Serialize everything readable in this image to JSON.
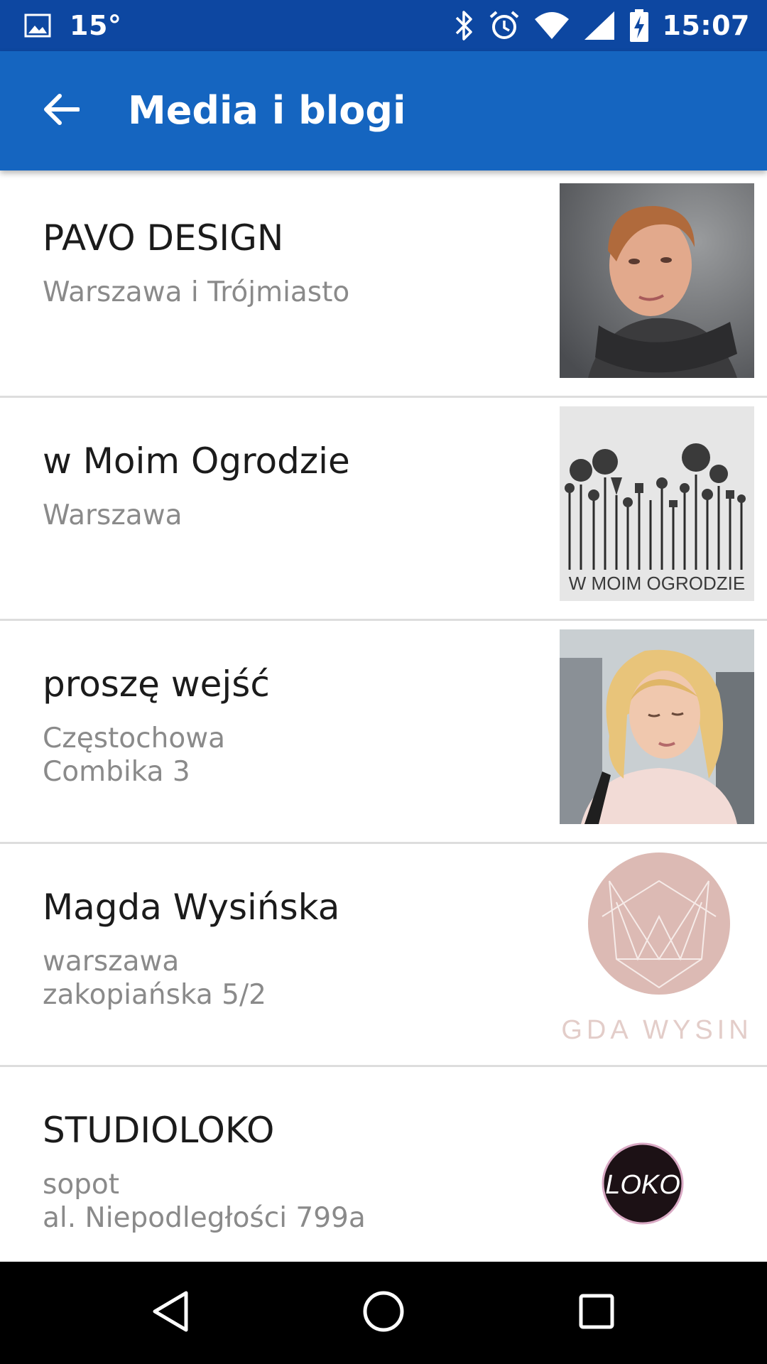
{
  "status_bar": {
    "temperature": "15°",
    "time": "15:07",
    "icons": [
      "image-icon",
      "bluetooth-icon",
      "alarm-icon",
      "wifi-icon",
      "signal-icon",
      "battery-charging-icon"
    ]
  },
  "app_bar": {
    "title": "Media i blogi",
    "back_icon": "arrow-back-icon",
    "color": "#1565c0",
    "status_color": "#0d47a1"
  },
  "items": [
    {
      "title": "PAVO DESIGN",
      "lines": [
        "Warszawa i Trójmiasto"
      ],
      "thumbnail": "portrait-photo"
    },
    {
      "title": "w Moim Ogrodzie",
      "lines": [
        "Warszawa"
      ],
      "thumbnail": "garden-tools-logo",
      "thumbnail_text": "W MOIM OGRODZIE"
    },
    {
      "title": "proszę wejść",
      "lines": [
        "Częstochowa",
        "Combika 3"
      ],
      "thumbnail": "portrait-photo"
    },
    {
      "title": "Magda Wysińska",
      "lines": [
        "warszawa",
        "zakopiańska 5/2"
      ],
      "thumbnail": "geometric-monogram-logo",
      "thumbnail_text": "GDA WYSIN"
    },
    {
      "title": "STUDIOLOKO",
      "lines": [
        "sopot",
        "al. Niepodległości 799a"
      ],
      "thumbnail": "loko-logo",
      "thumbnail_text": "LOKO"
    }
  ],
  "nav_bar": {
    "buttons": [
      "back-triangle-icon",
      "home-circle-icon",
      "recents-square-icon"
    ]
  }
}
